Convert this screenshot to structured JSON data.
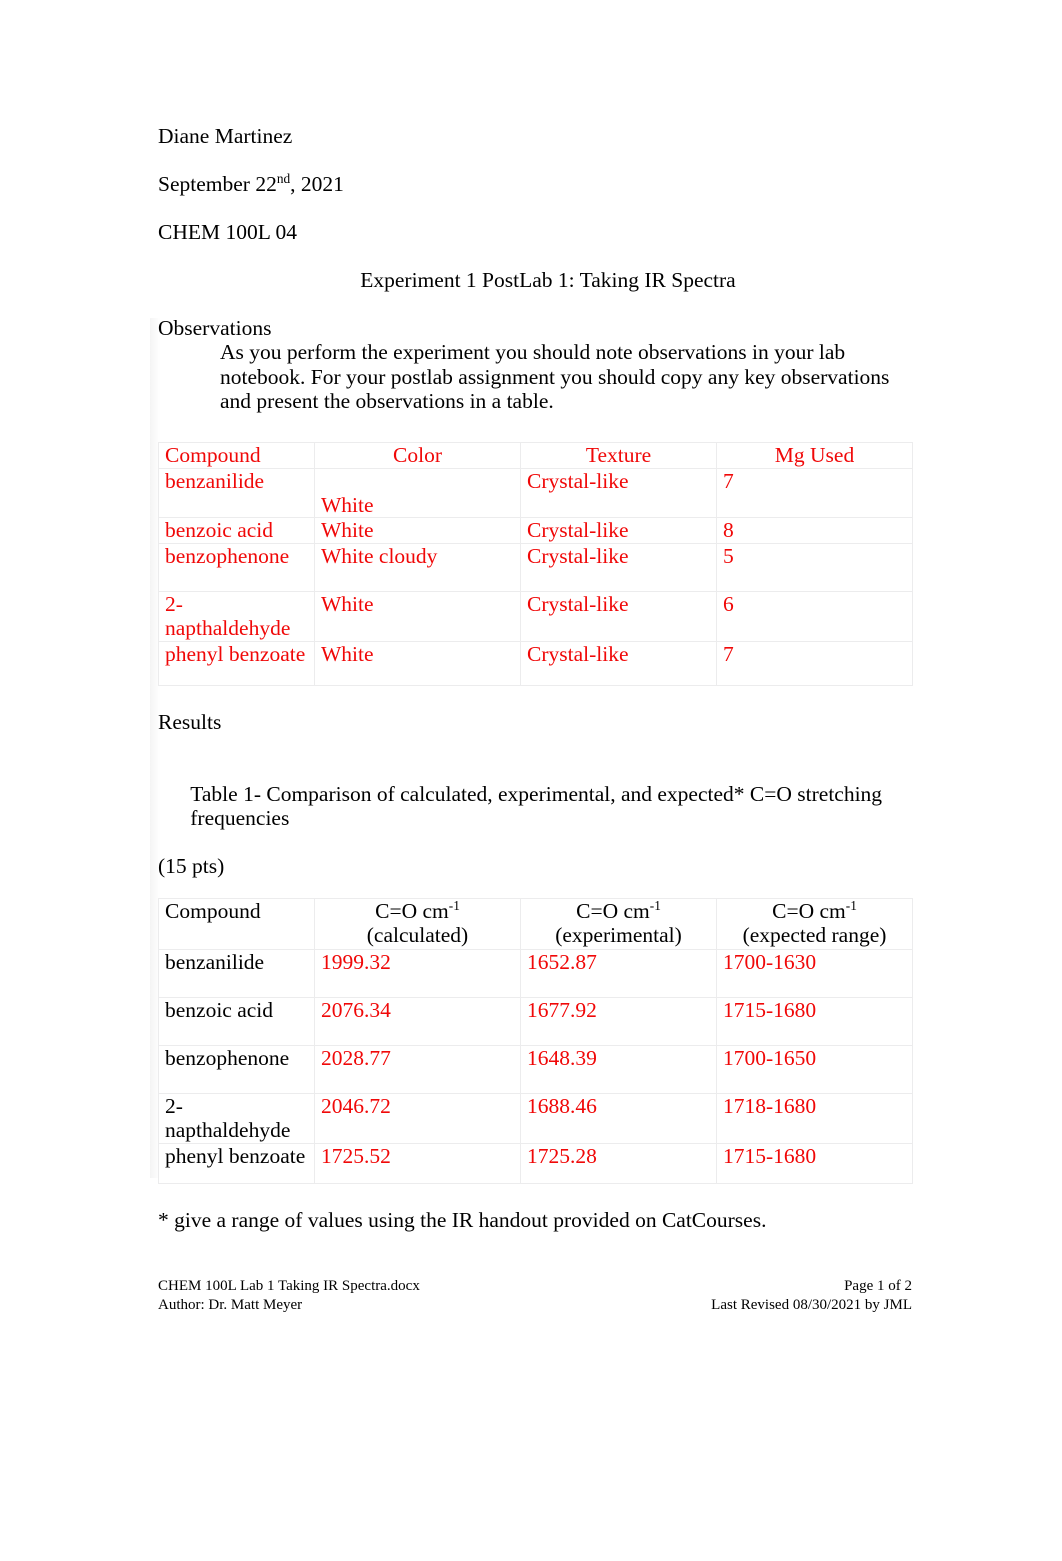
{
  "header": {
    "author_name": "Diane Martinez",
    "date_prefix": "September 22",
    "date_superscript": "nd",
    "date_suffix": ", 2021",
    "course": "CHEM 100L 04",
    "title": "Experiment 1 PostLab 1: Taking IR Spectra"
  },
  "observations": {
    "heading": "Observations",
    "body": "As you perform the experiment you should note observations in your lab notebook. For your postlab assignment you should copy any key observations and present the observations in a table.",
    "table": {
      "columns": [
        "Compound",
        "Color",
        "Texture",
        "Mg Used"
      ],
      "rows": [
        {
          "compound": "benzanilide",
          "color": "White",
          "color_on_second_line": true,
          "texture": "Crystal-like",
          "mg_used": "7"
        },
        {
          "compound": "benzoic acid",
          "color": "White",
          "color_on_second_line": false,
          "texture": "Crystal-like",
          "mg_used": "8"
        },
        {
          "compound": "benzophenone",
          "color": "White cloudy",
          "color_on_second_line": false,
          "texture": "Crystal-like",
          "mg_used": "5"
        },
        {
          "compound": "2-napthaldehyde",
          "color": "White",
          "color_on_second_line": false,
          "texture": "Crystal-like",
          "mg_used": "6"
        },
        {
          "compound": "phenyl benzoate",
          "color": "White",
          "color_on_second_line": false,
          "texture": "Crystal-like",
          "mg_used": "7"
        }
      ]
    }
  },
  "results": {
    "heading": "Results",
    "caption_line1": "Table 1- Comparison of calculated, experimental, and expected* C=O stretching",
    "caption_line2": "frequencies",
    "points": "(15 pts)",
    "table": {
      "col1_header": "Compound",
      "col2_header_main": "C=O cm",
      "col2_header_sup": "-1",
      "col2_header_sub": "(calculated)",
      "col3_header_main": "C=O cm",
      "col3_header_sup": "-1",
      "col3_header_sub": "(experimental)",
      "col4_header_main": "C=O cm",
      "col4_header_sup": "-1",
      "col4_header_sub": "(expected range)",
      "rows": [
        {
          "compound": "benzanilide",
          "calculated": "1999.32",
          "experimental": "1652.87",
          "expected_range": "1700-1630"
        },
        {
          "compound": "benzoic acid",
          "calculated": "2076.34",
          "experimental": "1677.92",
          "expected_range": "1715-1680"
        },
        {
          "compound": "benzophenone",
          "calculated": "2028.77",
          "experimental": "1648.39",
          "expected_range": "1700-1650"
        },
        {
          "compound": "2-napthaldehyde",
          "calculated": "2046.72",
          "experimental": "1688.46",
          "expected_range": "1718-1680"
        },
        {
          "compound": "phenyl benzoate",
          "calculated": "1725.52",
          "experimental": "1725.28",
          "expected_range": "1715-1680"
        }
      ]
    },
    "footnote": "* give a range of values using the IR handout provided on CatCourses."
  },
  "footer": {
    "file_name": "CHEM 100L Lab 1 Taking IR Spectra.docx",
    "author_line": "Author:  Dr. Matt Meyer",
    "page_number": "Page 1 of 2",
    "last_revised": "Last Revised 08/30/2021 by JML"
  },
  "colors": {
    "red_text": "#f00808",
    "black_text": "#000000",
    "table_border": "#ececed",
    "page_background": "#ffffff"
  }
}
